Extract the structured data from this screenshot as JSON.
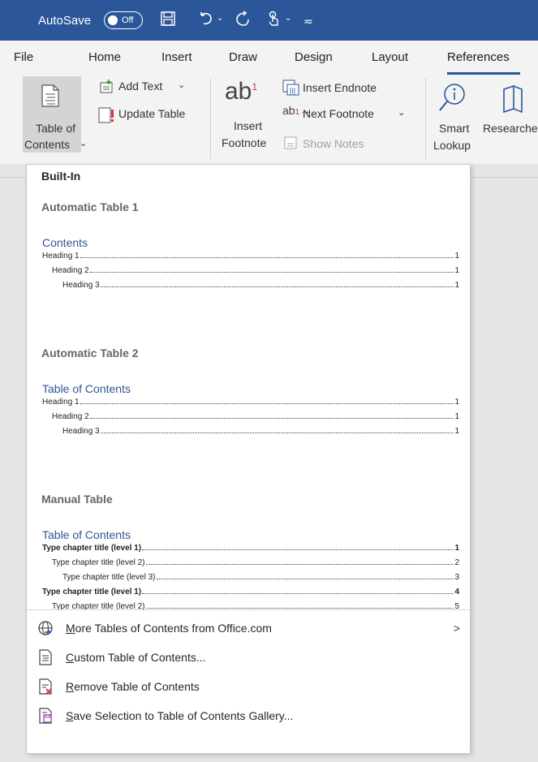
{
  "titlebar": {
    "autosave_label": "AutoSave",
    "toggle_state": "Off",
    "bg": "#2b579a"
  },
  "tabs": [
    {
      "label": "File"
    },
    {
      "label": "Home"
    },
    {
      "label": "Insert"
    },
    {
      "label": "Draw"
    },
    {
      "label": "Design"
    },
    {
      "label": "Layout"
    },
    {
      "label": "References",
      "active": true
    }
  ],
  "ribbon": {
    "toc_label_line1": "Table of",
    "toc_label_line2": "Contents",
    "add_text": "Add Text",
    "update_table": "Update Table",
    "insert_footnote_line1": "Insert",
    "insert_footnote_line2": "Footnote",
    "insert_endnote": "Insert Endnote",
    "next_footnote": "Next Footnote",
    "show_notes": "Show Notes",
    "smart_lookup_line1": "Smart",
    "smart_lookup_line2": "Lookup",
    "researcher": "Researcher",
    "research_group": "esearch"
  },
  "menu": {
    "builtin_header": "Built-In",
    "sections": [
      {
        "title": "Automatic Table 1",
        "preview_title": "Contents",
        "entries": [
          {
            "label": "Heading 1",
            "page": "1"
          },
          {
            "label": "Heading 2",
            "page": "1"
          },
          {
            "label": "Heading 3",
            "page": "1"
          }
        ]
      },
      {
        "title": "Automatic Table 2",
        "preview_title": "Table of Contents",
        "entries": [
          {
            "label": "Heading 1",
            "page": "1"
          },
          {
            "label": "Heading 2",
            "page": "1"
          },
          {
            "label": "Heading 3",
            "page": "1"
          }
        ]
      },
      {
        "title": "Manual Table",
        "preview_title": "Table of Contents",
        "entries": [
          {
            "label": "Type chapter title (level 1)",
            "page": "1"
          },
          {
            "label": "Type chapter title (level 2)",
            "page": "2"
          },
          {
            "label": "Type chapter title (level 3)",
            "page": "3"
          },
          {
            "label": "Type chapter title (level 1)",
            "page": "4"
          },
          {
            "label": "Type chapter title (level 2)",
            "page": "5"
          }
        ]
      }
    ],
    "items": [
      {
        "label": "More Tables of Contents from Office.com",
        "accel": "M",
        "rest": "ore Tables of Contents from Office.com",
        "icon": "globe-icon"
      },
      {
        "label": "Custom Table of Contents...",
        "accel": "C",
        "rest": "ustom Table of Contents...",
        "icon": "document-icon"
      },
      {
        "label": "Remove Table of Contents",
        "accel": "R",
        "rest": "emove Table of Contents",
        "icon": "remove-document-icon"
      },
      {
        "label": "Save Selection to Table of Contents Gallery...",
        "accel": "S",
        "rest": "ave Selection to Table of Contents Gallery...",
        "icon": "save-gallery-icon"
      }
    ]
  }
}
